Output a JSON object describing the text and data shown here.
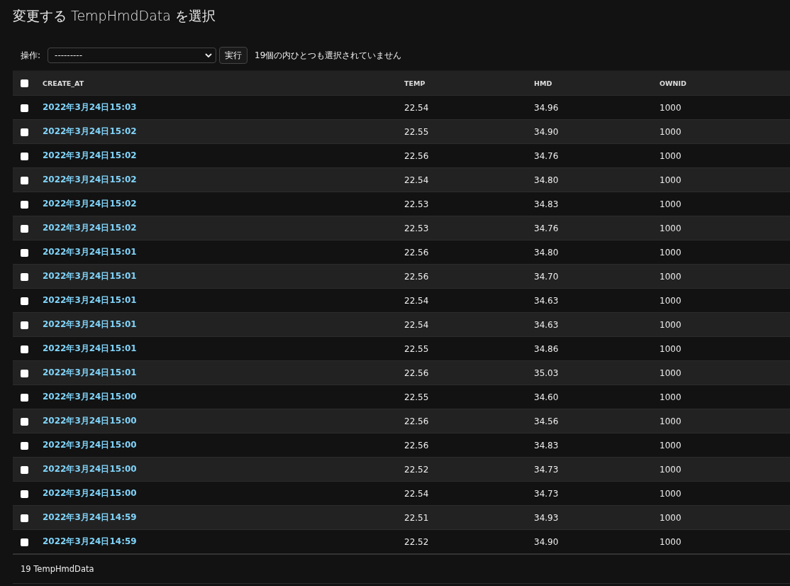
{
  "title": "変更する TempHmdData を選択",
  "actions": {
    "label": "操作:",
    "select_value": "---------",
    "run_button": "実行",
    "selection_count": "19個の内ひとつも選択されていません"
  },
  "table": {
    "select_all": {
      "checked": false
    },
    "columns": [
      "CREATE_AT",
      "TEMP",
      "HMD",
      "OWNID"
    ],
    "rows": [
      {
        "checked": false,
        "cells": [
          "2022年3月24日15:03",
          "22.54",
          "34.96",
          "1000"
        ]
      },
      {
        "checked": false,
        "cells": [
          "2022年3月24日15:02",
          "22.55",
          "34.90",
          "1000"
        ]
      },
      {
        "checked": false,
        "cells": [
          "2022年3月24日15:02",
          "22.56",
          "34.76",
          "1000"
        ]
      },
      {
        "checked": false,
        "cells": [
          "2022年3月24日15:02",
          "22.54",
          "34.80",
          "1000"
        ]
      },
      {
        "checked": false,
        "cells": [
          "2022年3月24日15:02",
          "22.53",
          "34.83",
          "1000"
        ]
      },
      {
        "checked": false,
        "cells": [
          "2022年3月24日15:02",
          "22.53",
          "34.76",
          "1000"
        ]
      },
      {
        "checked": false,
        "cells": [
          "2022年3月24日15:01",
          "22.56",
          "34.80",
          "1000"
        ]
      },
      {
        "checked": false,
        "cells": [
          "2022年3月24日15:01",
          "22.56",
          "34.70",
          "1000"
        ]
      },
      {
        "checked": false,
        "cells": [
          "2022年3月24日15:01",
          "22.54",
          "34.63",
          "1000"
        ]
      },
      {
        "checked": false,
        "cells": [
          "2022年3月24日15:01",
          "22.54",
          "34.63",
          "1000"
        ]
      },
      {
        "checked": false,
        "cells": [
          "2022年3月24日15:01",
          "22.55",
          "34.86",
          "1000"
        ]
      },
      {
        "checked": false,
        "cells": [
          "2022年3月24日15:01",
          "22.56",
          "35.03",
          "1000"
        ]
      },
      {
        "checked": false,
        "cells": [
          "2022年3月24日15:00",
          "22.55",
          "34.60",
          "1000"
        ]
      },
      {
        "checked": false,
        "cells": [
          "2022年3月24日15:00",
          "22.56",
          "34.56",
          "1000"
        ]
      },
      {
        "checked": false,
        "cells": [
          "2022年3月24日15:00",
          "22.56",
          "34.83",
          "1000"
        ]
      },
      {
        "checked": false,
        "cells": [
          "2022年3月24日15:00",
          "22.52",
          "34.73",
          "1000"
        ]
      },
      {
        "checked": false,
        "cells": [
          "2022年3月24日15:00",
          "22.54",
          "34.73",
          "1000"
        ]
      },
      {
        "checked": false,
        "cells": [
          "2022年3月24日14:59",
          "22.51",
          "34.93",
          "1000"
        ]
      },
      {
        "checked": false,
        "cells": [
          "2022年3月24日14:59",
          "22.52",
          "34.90",
          "1000"
        ]
      }
    ]
  },
  "footer": "19 TempHmdData"
}
